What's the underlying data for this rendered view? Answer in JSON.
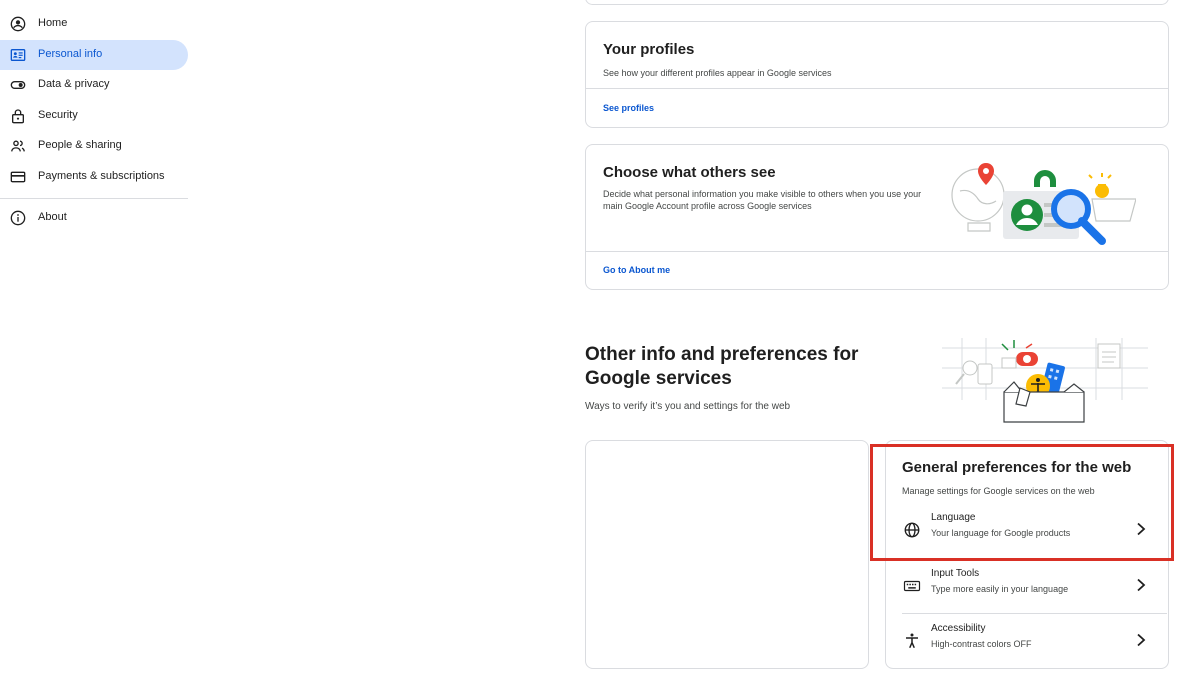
{
  "sidebar": {
    "items": [
      {
        "label": "Home",
        "icon": "account-circle-icon",
        "active": false
      },
      {
        "label": "Personal info",
        "icon": "id-card-icon",
        "active": true
      },
      {
        "label": "Data & privacy",
        "icon": "toggle-icon",
        "active": false
      },
      {
        "label": "Security",
        "icon": "lock-icon",
        "active": false
      },
      {
        "label": "People & sharing",
        "icon": "people-icon",
        "active": false
      },
      {
        "label": "Payments & subscriptions",
        "icon": "credit-card-icon",
        "active": false
      }
    ],
    "about_label": "About",
    "about_icon": "info-icon"
  },
  "profiles_card": {
    "title": "Your profiles",
    "description": "See how your different profiles appear in Google services",
    "link": "See profiles"
  },
  "others_see_card": {
    "title": "Choose what others see",
    "description": "Decide what personal information you make visible to others when you use your main Google Account profile across Google services",
    "link": "Go to About me"
  },
  "other_info_section": {
    "title": "Other info and preferences for Google services",
    "description": "Ways to verify it’s you and settings for the web"
  },
  "web_prefs_card": {
    "title": "General preferences for the web",
    "description": "Manage settings for Google services on the web",
    "rows": [
      {
        "title": "Language",
        "subtitle": "Your language for Google products",
        "icon": "globe-icon"
      },
      {
        "title": "Input Tools",
        "subtitle": "Type more easily in your language",
        "icon": "keyboard-icon"
      },
      {
        "title": "Accessibility",
        "subtitle": "High-contrast colors OFF",
        "icon": "accessibility-icon"
      }
    ]
  },
  "colors": {
    "accent": "#0b57d0",
    "active_nav_bg": "#d3e3fd",
    "highlight": "#d93025",
    "border": "#dadce0"
  }
}
